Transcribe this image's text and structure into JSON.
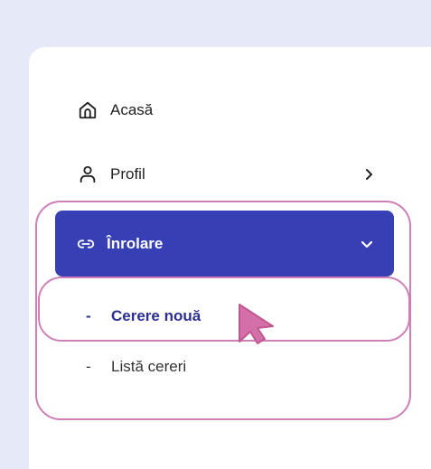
{
  "menu": {
    "home": {
      "label": "Acasă",
      "icon": "home-icon"
    },
    "profile": {
      "label": "Profil",
      "icon": "user-icon",
      "chevron": "chevron-right-icon"
    },
    "enrollment": {
      "label": "Înrolare",
      "icon": "link-icon",
      "chevron": "chevron-down-icon",
      "expanded": true,
      "submenu": [
        {
          "dash": "-",
          "label": "Cerere nouă",
          "highlighted": true
        },
        {
          "dash": "-",
          "label": "Listă cereri"
        }
      ]
    }
  },
  "colors": {
    "page_background": "#e6e9f7",
    "active_item": "#3640b4",
    "highlight_outline": "#cf7fb8",
    "submenu_active_text": "#2c2f8f"
  }
}
